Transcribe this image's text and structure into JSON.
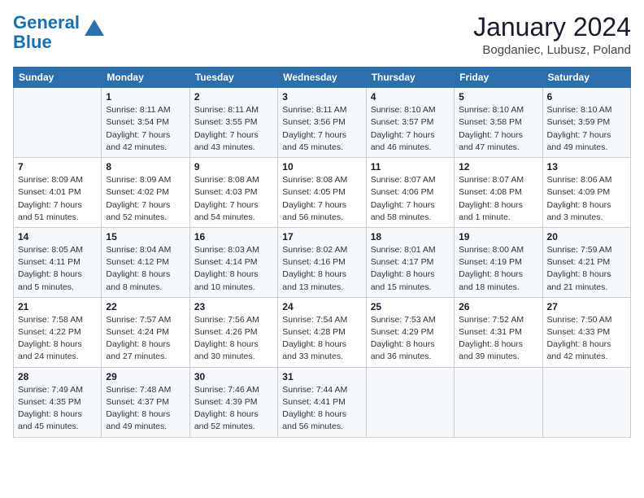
{
  "logo": {
    "line1": "General",
    "line2": "Blue"
  },
  "title": "January 2024",
  "subtitle": "Bogdaniec, Lubusz, Poland",
  "days_of_week": [
    "Sunday",
    "Monday",
    "Tuesday",
    "Wednesday",
    "Thursday",
    "Friday",
    "Saturday"
  ],
  "weeks": [
    [
      {
        "day": "",
        "info": ""
      },
      {
        "day": "1",
        "info": "Sunrise: 8:11 AM\nSunset: 3:54 PM\nDaylight: 7 hours\nand 42 minutes."
      },
      {
        "day": "2",
        "info": "Sunrise: 8:11 AM\nSunset: 3:55 PM\nDaylight: 7 hours\nand 43 minutes."
      },
      {
        "day": "3",
        "info": "Sunrise: 8:11 AM\nSunset: 3:56 PM\nDaylight: 7 hours\nand 45 minutes."
      },
      {
        "day": "4",
        "info": "Sunrise: 8:10 AM\nSunset: 3:57 PM\nDaylight: 7 hours\nand 46 minutes."
      },
      {
        "day": "5",
        "info": "Sunrise: 8:10 AM\nSunset: 3:58 PM\nDaylight: 7 hours\nand 47 minutes."
      },
      {
        "day": "6",
        "info": "Sunrise: 8:10 AM\nSunset: 3:59 PM\nDaylight: 7 hours\nand 49 minutes."
      }
    ],
    [
      {
        "day": "7",
        "info": "Sunrise: 8:09 AM\nSunset: 4:01 PM\nDaylight: 7 hours\nand 51 minutes."
      },
      {
        "day": "8",
        "info": "Sunrise: 8:09 AM\nSunset: 4:02 PM\nDaylight: 7 hours\nand 52 minutes."
      },
      {
        "day": "9",
        "info": "Sunrise: 8:08 AM\nSunset: 4:03 PM\nDaylight: 7 hours\nand 54 minutes."
      },
      {
        "day": "10",
        "info": "Sunrise: 8:08 AM\nSunset: 4:05 PM\nDaylight: 7 hours\nand 56 minutes."
      },
      {
        "day": "11",
        "info": "Sunrise: 8:07 AM\nSunset: 4:06 PM\nDaylight: 7 hours\nand 58 minutes."
      },
      {
        "day": "12",
        "info": "Sunrise: 8:07 AM\nSunset: 4:08 PM\nDaylight: 8 hours\nand 1 minute."
      },
      {
        "day": "13",
        "info": "Sunrise: 8:06 AM\nSunset: 4:09 PM\nDaylight: 8 hours\nand 3 minutes."
      }
    ],
    [
      {
        "day": "14",
        "info": "Sunrise: 8:05 AM\nSunset: 4:11 PM\nDaylight: 8 hours\nand 5 minutes."
      },
      {
        "day": "15",
        "info": "Sunrise: 8:04 AM\nSunset: 4:12 PM\nDaylight: 8 hours\nand 8 minutes."
      },
      {
        "day": "16",
        "info": "Sunrise: 8:03 AM\nSunset: 4:14 PM\nDaylight: 8 hours\nand 10 minutes."
      },
      {
        "day": "17",
        "info": "Sunrise: 8:02 AM\nSunset: 4:16 PM\nDaylight: 8 hours\nand 13 minutes."
      },
      {
        "day": "18",
        "info": "Sunrise: 8:01 AM\nSunset: 4:17 PM\nDaylight: 8 hours\nand 15 minutes."
      },
      {
        "day": "19",
        "info": "Sunrise: 8:00 AM\nSunset: 4:19 PM\nDaylight: 8 hours\nand 18 minutes."
      },
      {
        "day": "20",
        "info": "Sunrise: 7:59 AM\nSunset: 4:21 PM\nDaylight: 8 hours\nand 21 minutes."
      }
    ],
    [
      {
        "day": "21",
        "info": "Sunrise: 7:58 AM\nSunset: 4:22 PM\nDaylight: 8 hours\nand 24 minutes."
      },
      {
        "day": "22",
        "info": "Sunrise: 7:57 AM\nSunset: 4:24 PM\nDaylight: 8 hours\nand 27 minutes."
      },
      {
        "day": "23",
        "info": "Sunrise: 7:56 AM\nSunset: 4:26 PM\nDaylight: 8 hours\nand 30 minutes."
      },
      {
        "day": "24",
        "info": "Sunrise: 7:54 AM\nSunset: 4:28 PM\nDaylight: 8 hours\nand 33 minutes."
      },
      {
        "day": "25",
        "info": "Sunrise: 7:53 AM\nSunset: 4:29 PM\nDaylight: 8 hours\nand 36 minutes."
      },
      {
        "day": "26",
        "info": "Sunrise: 7:52 AM\nSunset: 4:31 PM\nDaylight: 8 hours\nand 39 minutes."
      },
      {
        "day": "27",
        "info": "Sunrise: 7:50 AM\nSunset: 4:33 PM\nDaylight: 8 hours\nand 42 minutes."
      }
    ],
    [
      {
        "day": "28",
        "info": "Sunrise: 7:49 AM\nSunset: 4:35 PM\nDaylight: 8 hours\nand 45 minutes."
      },
      {
        "day": "29",
        "info": "Sunrise: 7:48 AM\nSunset: 4:37 PM\nDaylight: 8 hours\nand 49 minutes."
      },
      {
        "day": "30",
        "info": "Sunrise: 7:46 AM\nSunset: 4:39 PM\nDaylight: 8 hours\nand 52 minutes."
      },
      {
        "day": "31",
        "info": "Sunrise: 7:44 AM\nSunset: 4:41 PM\nDaylight: 8 hours\nand 56 minutes."
      },
      {
        "day": "",
        "info": ""
      },
      {
        "day": "",
        "info": ""
      },
      {
        "day": "",
        "info": ""
      }
    ]
  ]
}
